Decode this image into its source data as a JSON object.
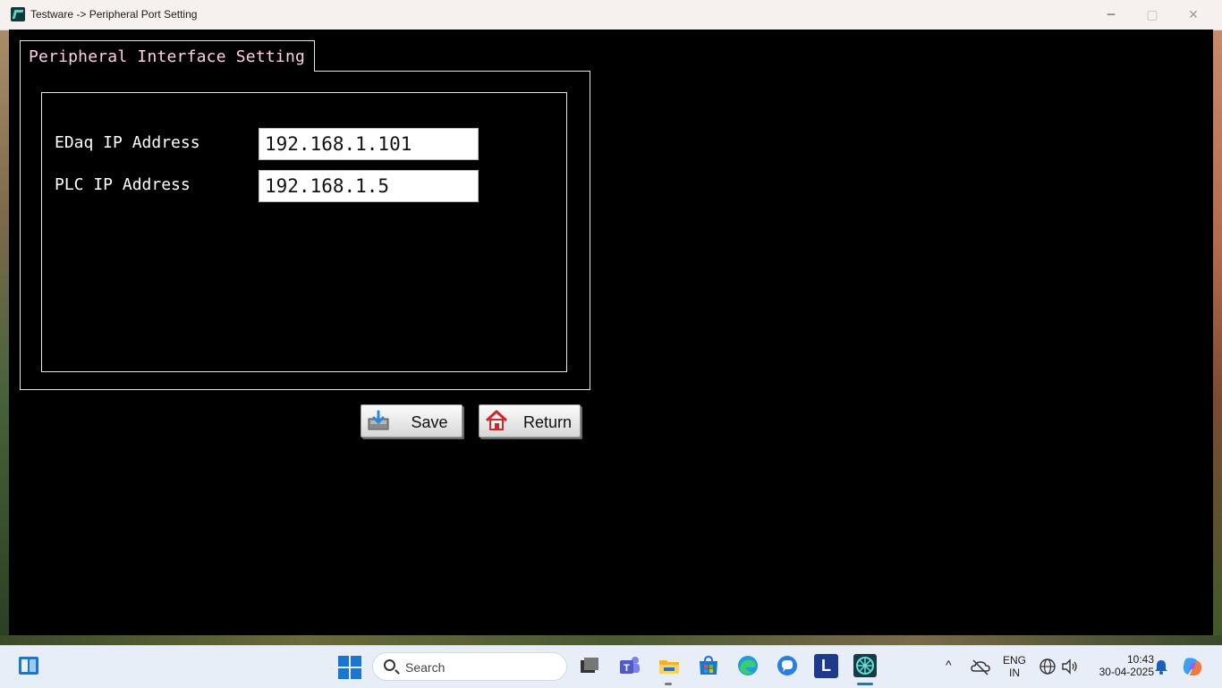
{
  "window": {
    "title": "Testware -> Peripheral Port Setting",
    "minimize_glyph": "─",
    "maximize_glyph": "▢",
    "close_glyph": "✕"
  },
  "tab": {
    "label": "Peripheral Interface Setting"
  },
  "fields": {
    "edaq": {
      "label": "EDaq IP Address",
      "value": "192.168.1.101"
    },
    "plc": {
      "label": "PLC IP Address",
      "value": "192.168.1.5"
    }
  },
  "buttons": {
    "save_label": "Save",
    "return_label": "Return"
  },
  "taskbar": {
    "search_placeholder": "Search",
    "language_line1": "ENG",
    "language_line2": "IN",
    "time": "10:43",
    "date": "30-04-2025",
    "pinned_l_label": "L",
    "chevron_glyph": "^"
  },
  "colors": {
    "tab_label": "#ffd0e8",
    "client_background": "#000000",
    "accent": "#1a76d2"
  }
}
